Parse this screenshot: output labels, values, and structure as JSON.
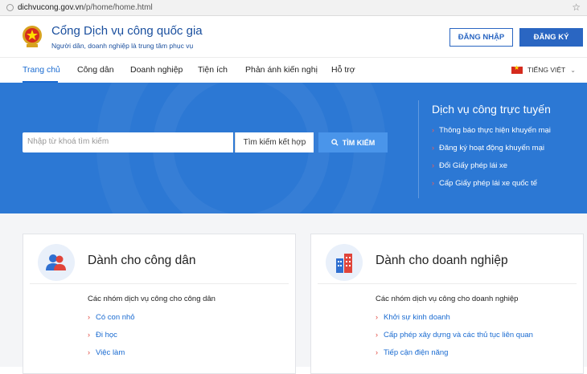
{
  "browser": {
    "url_domain": "dichvucong.gov.vn",
    "url_path": "/p/home/home.html"
  },
  "header": {
    "title": "Cổng Dịch vụ công quốc gia",
    "subtitle": "Người dân, doanh nghiệp là trung tâm phục vụ",
    "login_label": "ĐĂNG NHẬP",
    "register_label": "ĐĂNG KÝ"
  },
  "nav": {
    "items": [
      {
        "label": "Trang chủ"
      },
      {
        "label": "Công dân"
      },
      {
        "label": "Doanh nghiệp"
      },
      {
        "label": "Tiện ích"
      },
      {
        "label": "Phản ánh kiến nghị"
      },
      {
        "label": "Hỗ trợ"
      }
    ],
    "language": "TIẾNG VIỆT"
  },
  "hero": {
    "search_placeholder": "Nhập từ khoá tìm kiếm",
    "advanced_search": "Tìm kiếm kết hợp",
    "search_button": "TÌM KIẾM",
    "online_title": "Dịch vụ công trực tuyến",
    "online_items": [
      {
        "label": "Thông báo thực hiện khuyến mại"
      },
      {
        "label": "Đăng ký hoạt động khuyến mại"
      },
      {
        "label": "Đổi Giấy phép lái xe"
      },
      {
        "label": "Cấp Giấy phép lái xe quốc tế"
      }
    ]
  },
  "cards": {
    "citizen": {
      "title": "Dành cho công dân",
      "subtitle": "Các nhóm dịch vụ công cho công dân",
      "links": [
        {
          "label": "Có con nhỏ"
        },
        {
          "label": "Đi học"
        },
        {
          "label": "Việc làm"
        }
      ]
    },
    "business": {
      "title": "Dành cho doanh nghiệp",
      "subtitle": "Các nhóm dịch vụ công cho doanh nghiệp",
      "links": [
        {
          "label": "Khởi sự kinh doanh"
        },
        {
          "label": "Cấp phép xây dựng và các thủ tục liên quan"
        },
        {
          "label": "Tiếp cận điện năng"
        }
      ]
    }
  },
  "colors": {
    "brand_blue": "#2a66c2",
    "hero_blue": "#2c78d4",
    "accent_red": "#e0443a"
  }
}
